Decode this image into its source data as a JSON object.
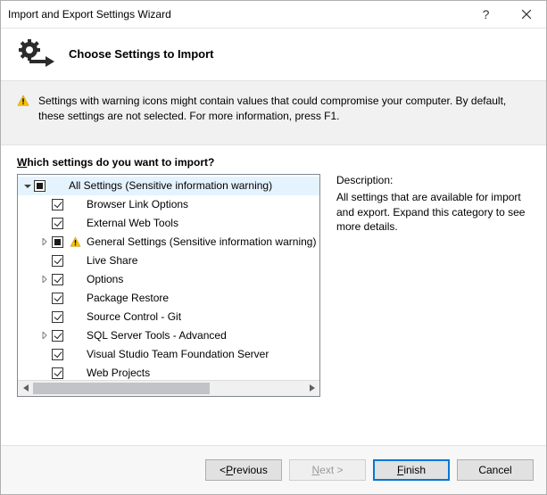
{
  "window": {
    "title": "Import and Export Settings Wizard"
  },
  "header": {
    "heading": "Choose Settings to Import"
  },
  "banner": {
    "text": "Settings with warning icons might contain values that could compromise your computer. By default, these settings are not selected. For more information, press F1."
  },
  "prompt": {
    "prefix": "Which settings do you want to import?"
  },
  "tree": {
    "root": {
      "label": "All Settings (Sensitive information warning)",
      "check": "indeterminate",
      "warning": false,
      "expanded": true,
      "selected": true
    },
    "children": [
      {
        "label": "Browser Link Options",
        "check": "checked",
        "expandable": false,
        "warning": false
      },
      {
        "label": "External Web Tools",
        "check": "checked",
        "expandable": false,
        "warning": false
      },
      {
        "label": "General Settings (Sensitive information warning)",
        "check": "indeterminate",
        "expandable": true,
        "warning": true
      },
      {
        "label": "Live Share",
        "check": "checked",
        "expandable": false,
        "warning": false
      },
      {
        "label": "Options",
        "check": "checked",
        "expandable": true,
        "warning": false
      },
      {
        "label": "Package Restore",
        "check": "checked",
        "expandable": false,
        "warning": false
      },
      {
        "label": "Source Control - Git",
        "check": "checked",
        "expandable": false,
        "warning": false
      },
      {
        "label": "SQL Server Tools - Advanced",
        "check": "checked",
        "expandable": true,
        "warning": false
      },
      {
        "label": "Visual Studio Team Foundation Server",
        "check": "checked",
        "expandable": false,
        "warning": false
      },
      {
        "label": "Web Projects",
        "check": "checked",
        "expandable": false,
        "warning": false
      }
    ]
  },
  "description": {
    "heading": "Description:",
    "body": "All settings that are available for import and export. Expand this category to see more details."
  },
  "buttons": {
    "previous": "< Previous",
    "next": "Next >",
    "finish": "Finish",
    "cancel": "Cancel"
  }
}
